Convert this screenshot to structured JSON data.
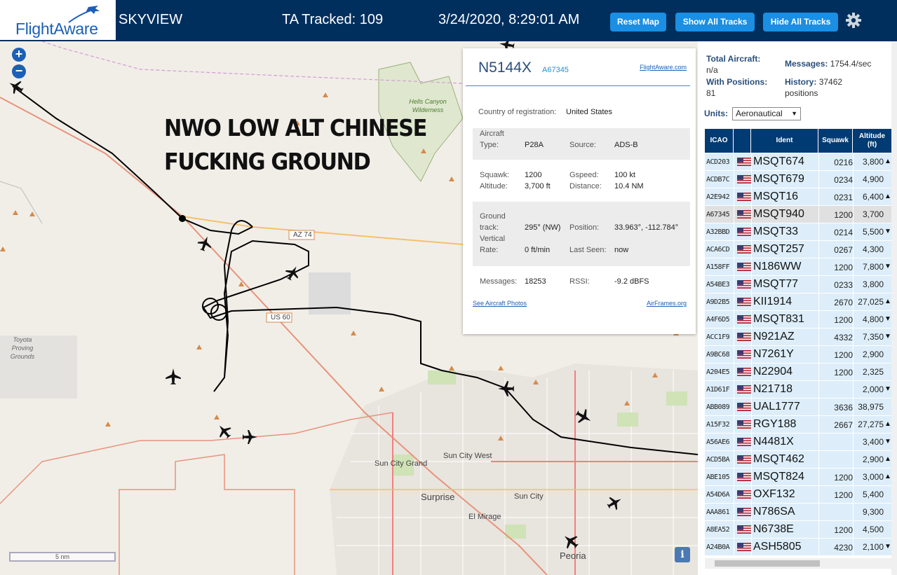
{
  "header": {
    "logo_text": "FlightAware",
    "app_name": "SKYVIEW",
    "tracked": "TA Tracked: 109",
    "datetime": "3/24/2020, 8:29:01 AM",
    "btn_reset": "Reset Map",
    "btn_show": "Show All Tracks",
    "btn_hide": "Hide All Tracks"
  },
  "map": {
    "zoom_in": "+",
    "zoom_out": "−",
    "overlay_line1": "NWO LOW ALT CHINESE",
    "overlay_line2": "FUCKING GROUND",
    "scale_label": "5 nm",
    "info_label": "i",
    "places": {
      "hells_canyon": "Hells Canyon Wilderness",
      "toyota": "Toyota Proving Grounds",
      "az74": "AZ 74",
      "us60": "US 60",
      "sun_city_grand": "Sun City Grand",
      "sun_city_west": "Sun City West",
      "surprise": "Surprise",
      "sun_city": "Sun City",
      "el_mirage": "El Mirage",
      "peoria": "Peoria"
    }
  },
  "popup": {
    "registration": "N5144X",
    "hex": "A67345",
    "fa_link": "FlightAware.com",
    "country_label": "Country of registration:",
    "country_value": "United States",
    "aircraft_type_label": "Aircraft Type:",
    "aircraft_type_label_1": "Aircraft",
    "aircraft_type_label_2": "Type:",
    "aircraft_type": "P28A",
    "source_label": "Source:",
    "source": "ADS-B",
    "squawk_label": "Squawk:",
    "squawk": "1200",
    "gspeed_label": "Gspeed:",
    "gspeed": "100 kt",
    "altitude_label": "Altitude:",
    "altitude": "3,700 ft",
    "distance_label": "Distance:",
    "distance": "10.4 NM",
    "gt_label_1": "Ground",
    "gt_label_2": "track:",
    "ground_track": "295° (NW)",
    "position_label": "Position:",
    "position": "33.963°, -112.784°",
    "vr_label_1": "Vertical",
    "vr_label_2": "Rate:",
    "vertical_rate": "0 ft/min",
    "last_seen_label": "Last Seen:",
    "last_seen": "now",
    "messages_label": "Messages:",
    "messages": "18253",
    "rssi_label": "RSSI:",
    "rssi": "-9.2 dBFS",
    "photos_link": "See Aircraft Photos",
    "airframes_link": "AirFrames.org"
  },
  "panel": {
    "total_label": "Total Aircraft:",
    "total_value": "n/a",
    "messages_label": "Messages:",
    "messages_value": "1754.4/sec",
    "positions_label": "With Positions:",
    "positions_value": "81",
    "history_label": "History:",
    "history_value_1": "37462",
    "history_value_2": "positions",
    "units_label": "Units:",
    "units_value": "Aeronautical",
    "columns": [
      "ICAO",
      "",
      "Ident",
      "Squawk",
      "Altitude (ft)"
    ],
    "rows": [
      {
        "icao": "ACD203",
        "ident": "MSQT674",
        "squawk": "0216",
        "alt": "3,800",
        "arrow": "▲"
      },
      {
        "icao": "ACDB7C",
        "ident": "MSQT679",
        "squawk": "0234",
        "alt": "4,900",
        "arrow": ""
      },
      {
        "icao": "A2E942",
        "ident": "MSQT16",
        "squawk": "0231",
        "alt": "6,400",
        "arrow": "▲"
      },
      {
        "icao": "A67345",
        "ident": "MSQT940",
        "squawk": "1200",
        "alt": "3,700",
        "arrow": ""
      },
      {
        "icao": "A32BBD",
        "ident": "MSQT33",
        "squawk": "0214",
        "alt": "5,500",
        "arrow": "▼"
      },
      {
        "icao": "ACA6CD",
        "ident": "MSQT257",
        "squawk": "0267",
        "alt": "4,300",
        "arrow": ""
      },
      {
        "icao": "A158FF",
        "ident": "N186WW",
        "squawk": "1200",
        "alt": "7,800",
        "arrow": "▼"
      },
      {
        "icao": "A54BE3",
        "ident": "MSQT77",
        "squawk": "0233",
        "alt": "3,800",
        "arrow": ""
      },
      {
        "icao": "A9D2B5",
        "ident": "KII1914",
        "squawk": "2670",
        "alt": "27,025",
        "arrow": "▲"
      },
      {
        "icao": "A4F6D5",
        "ident": "MSQT831",
        "squawk": "1200",
        "alt": "4,800",
        "arrow": "▼"
      },
      {
        "icao": "ACC1F9",
        "ident": "N921AZ",
        "squawk": "4332",
        "alt": "7,350",
        "arrow": "▼"
      },
      {
        "icao": "A9BC68",
        "ident": "N7261Y",
        "squawk": "1200",
        "alt": "2,900",
        "arrow": ""
      },
      {
        "icao": "A204E5",
        "ident": "N22904",
        "squawk": "1200",
        "alt": "2,325",
        "arrow": ""
      },
      {
        "icao": "A1D61F",
        "ident": "N21718",
        "squawk": "",
        "alt": "2,000",
        "arrow": "▼"
      },
      {
        "icao": "ABB089",
        "ident": "UAL1777",
        "squawk": "3636",
        "alt": "38,975",
        "arrow": ""
      },
      {
        "icao": "A15F32",
        "ident": "RGY188",
        "squawk": "2667",
        "alt": "27,275",
        "arrow": "▲"
      },
      {
        "icao": "A56AE6",
        "ident": "N4481X",
        "squawk": "",
        "alt": "3,400",
        "arrow": "▼"
      },
      {
        "icao": "ACD5BA",
        "ident": "MSQT462",
        "squawk": "",
        "alt": "2,900",
        "arrow": "▲"
      },
      {
        "icao": "ABE105",
        "ident": "MSQT824",
        "squawk": "1200",
        "alt": "3,000",
        "arrow": "▲"
      },
      {
        "icao": "A54D6A",
        "ident": "OXF132",
        "squawk": "1200",
        "alt": "5,400",
        "arrow": ""
      },
      {
        "icao": "AAA861",
        "ident": "N786SA",
        "squawk": "",
        "alt": "9,300",
        "arrow": ""
      },
      {
        "icao": "A8EA52",
        "ident": "N6738E",
        "squawk": "1200",
        "alt": "4,500",
        "arrow": ""
      },
      {
        "icao": "A24B0A",
        "ident": "ASH5805",
        "squawk": "4230",
        "alt": "2,100",
        "arrow": "▼"
      }
    ],
    "selected_index": 3
  },
  "colors": {
    "header_bg": "#002f5d",
    "button_blue": "#1a8fe3",
    "table_header": "#003b73",
    "row_bg": "#ddeefa",
    "map_bg": "#f1eee8"
  }
}
